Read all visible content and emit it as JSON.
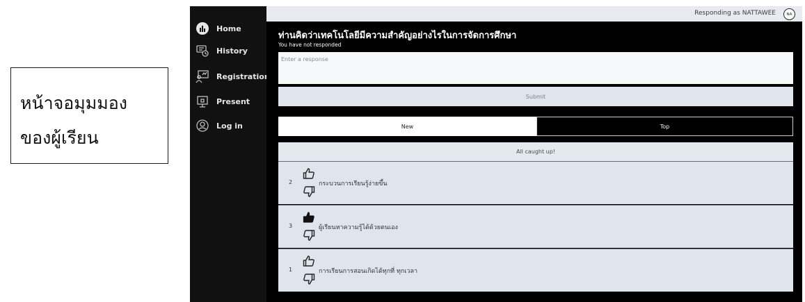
{
  "caption": {
    "line1": "หน้าจอมุมมอง",
    "line2": "ของผู้เรียน"
  },
  "sidebar": {
    "items": [
      {
        "label": "Home",
        "icon": "chart-circle-icon"
      },
      {
        "label": "History",
        "icon": "history-icon"
      },
      {
        "label": "Registration",
        "icon": "registration-icon"
      },
      {
        "label": "Present",
        "icon": "present-icon"
      },
      {
        "label": "Log in",
        "icon": "user-circle-icon"
      }
    ]
  },
  "header": {
    "responding_as": "Responding as NATTAWEE",
    "avatar_initials": "NA"
  },
  "question": {
    "title": "ท่านคิดว่าเทคโนโลยีมีความสำคัญอย่างไรในการจัดการศึกษา",
    "status": "You have not responded"
  },
  "form": {
    "placeholder": "Enter a response",
    "submit_label": "Submit"
  },
  "tabs": {
    "new_label": "New",
    "top_label": "Top"
  },
  "feed": {
    "caught_up": "All caught up!",
    "responses": [
      {
        "votes": "2",
        "text": "กระบวนการเรียนรู้ง่ายขึ้น",
        "upvoted": false
      },
      {
        "votes": "3",
        "text": "ผู้เรียนหาความรู้ได้ด้วยตนเอง",
        "upvoted": true
      },
      {
        "votes": "1",
        "text": "การเรียนการสอนเกิดได้ทุกที่ ทุกเวลา",
        "upvoted": false
      }
    ]
  },
  "colors": {
    "sidebar_bg": "#111111",
    "main_bg": "#000000",
    "topbar_bg": "#e7ebef",
    "row_bg": "#dfe5ec",
    "text_light": "#ffffff"
  }
}
